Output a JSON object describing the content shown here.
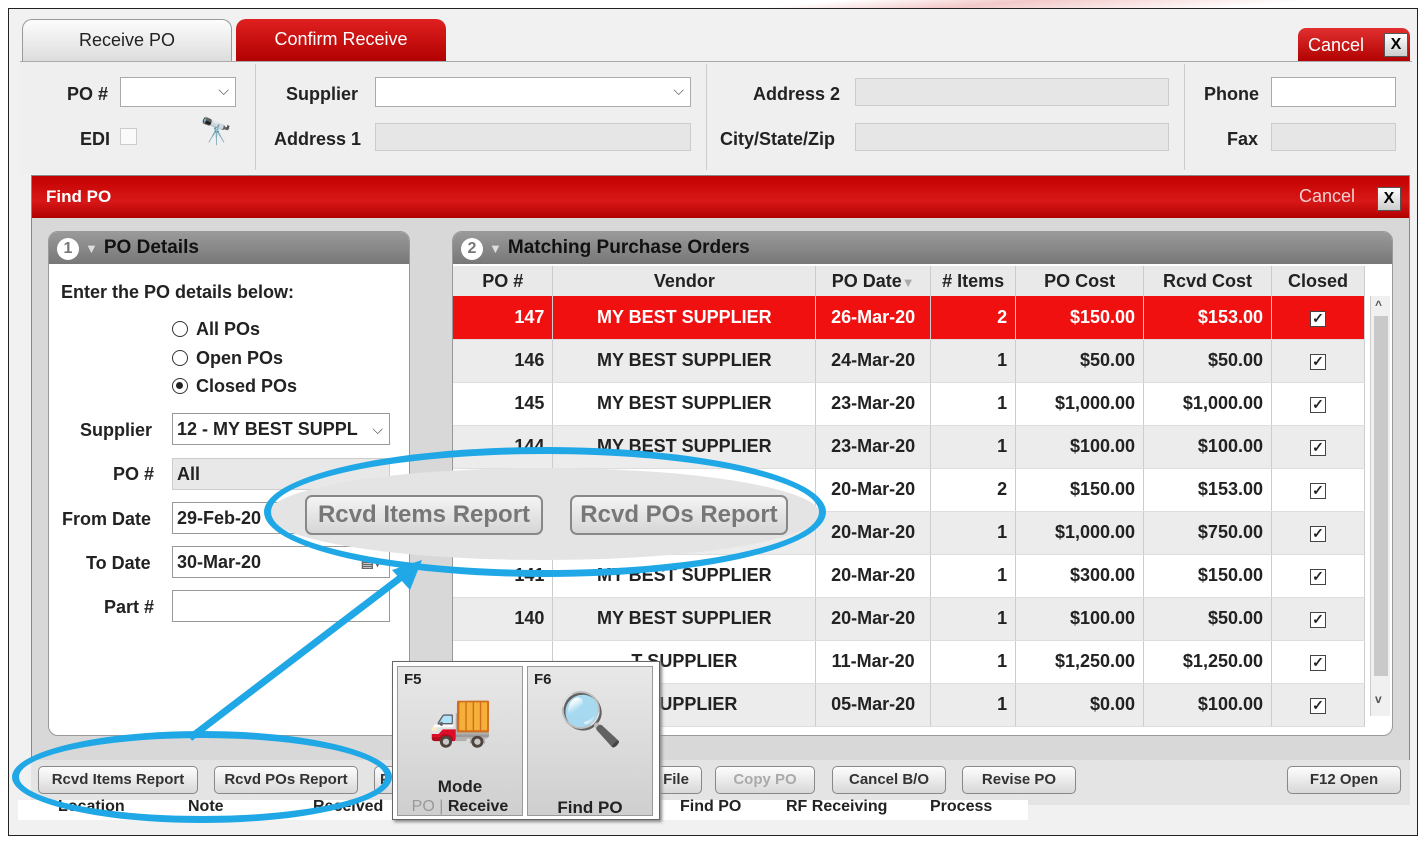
{
  "tabs": {
    "receive": "Receive PO",
    "confirm": "Confirm Receive",
    "cancel": "Cancel",
    "close": "X"
  },
  "header": {
    "po_label": "PO #",
    "edi_label": "EDI",
    "supplier_label": "Supplier",
    "address1_label": "Address 1",
    "address2_label": "Address 2",
    "city_label": "City/State/Zip",
    "phone_label": "Phone",
    "fax_label": "Fax"
  },
  "dialog": {
    "title": "Find PO",
    "cancel": "Cancel",
    "close": "X"
  },
  "left_panel": {
    "number": "1",
    "title": "PO Details",
    "intro": "Enter the PO details below:",
    "radios": [
      "All POs",
      "Open POs",
      "Closed POs"
    ],
    "selected": "Closed POs",
    "supplier_label": "Supplier",
    "supplier_value": "12 - MY BEST SUPPL",
    "po_label": "PO #",
    "po_value": "All",
    "from_label": "From Date",
    "from_value": "29-Feb-20",
    "to_label": "To Date",
    "to_value": "30-Mar-20",
    "part_label": "Part #",
    "part_value": ""
  },
  "right_panel": {
    "number": "2",
    "title": "Matching Purchase Orders",
    "columns": [
      "PO #",
      "Vendor",
      "PO Date",
      "# Items",
      "PO Cost",
      "Rcvd Cost",
      "Closed"
    ],
    "rows": [
      {
        "po": "147",
        "vendor": "MY BEST SUPPLIER",
        "date": "26-Mar-20",
        "items": "2",
        "cost": "$150.00",
        "rcvd": "$153.00"
      },
      {
        "po": "146",
        "vendor": "MY BEST SUPPLIER",
        "date": "24-Mar-20",
        "items": "1",
        "cost": "$50.00",
        "rcvd": "$50.00"
      },
      {
        "po": "145",
        "vendor": "MY BEST SUPPLIER",
        "date": "23-Mar-20",
        "items": "1",
        "cost": "$1,000.00",
        "rcvd": "$1,000.00"
      },
      {
        "po": "144",
        "vendor": "MY BEST SUPPLIER",
        "date": "23-Mar-20",
        "items": "1",
        "cost": "$100.00",
        "rcvd": "$100.00"
      },
      {
        "po": "",
        "vendor": "",
        "date": "20-Mar-20",
        "items": "2",
        "cost": "$150.00",
        "rcvd": "$153.00"
      },
      {
        "po": "",
        "vendor": "",
        "date": "20-Mar-20",
        "items": "1",
        "cost": "$1,000.00",
        "rcvd": "$750.00"
      },
      {
        "po": "141",
        "vendor": "MY BEST SUPPLIER",
        "date": "20-Mar-20",
        "items": "1",
        "cost": "$300.00",
        "rcvd": "$150.00"
      },
      {
        "po": "140",
        "vendor": "MY BEST SUPPLIER",
        "date": "20-Mar-20",
        "items": "1",
        "cost": "$100.00",
        "rcvd": "$50.00"
      },
      {
        "po": "",
        "vendor": "T SUPPLIER",
        "date": "11-Mar-20",
        "items": "1",
        "cost": "$1,250.00",
        "rcvd": "$1,250.00"
      },
      {
        "po": "",
        "vendor": "T SUPPLIER",
        "date": "05-Mar-20",
        "items": "1",
        "cost": "$0.00",
        "rcvd": "$100.00"
      }
    ]
  },
  "callout": {
    "items_report": "Rcvd Items Report",
    "pos_report": "Rcvd POs Report"
  },
  "buttons": {
    "items_report": "Rcvd Items Report",
    "pos_report": "Rcvd POs Report",
    "p": "P",
    "file": "File",
    "copy": "Copy PO",
    "cancel_bo": "Cancel B/O",
    "revise": "Revise PO",
    "open": "F12 Open"
  },
  "footer": [
    "Location",
    "Note",
    "Received",
    "Find PO",
    "RF Receiving",
    "Process"
  ],
  "popup": {
    "f5": "F5",
    "mode": "Mode",
    "po": "PO",
    "sep": " | ",
    "receive": "Receive",
    "f6": "F6",
    "find": "Find PO"
  },
  "colors": {
    "accent": "#e01010",
    "highlight": "#1fa7e6"
  }
}
